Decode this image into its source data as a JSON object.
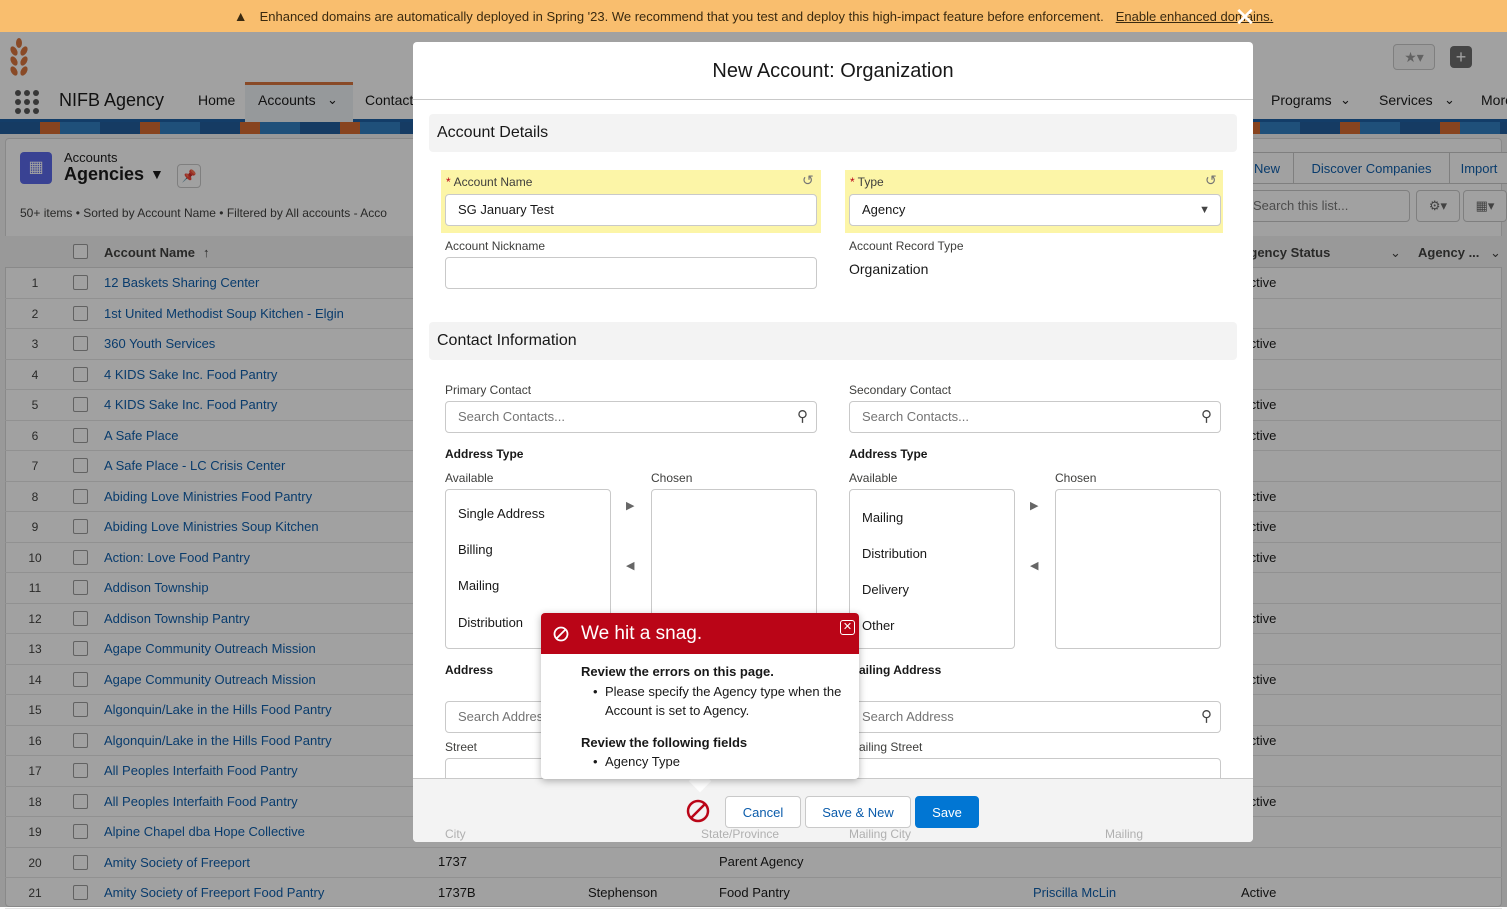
{
  "banner": {
    "text": "Enhanced domains are automatically deployed in Spring '23. We recommend that you test and deploy this high-impact feature before enforcement.",
    "link": "Enable enhanced domains."
  },
  "nav": {
    "app_name": "NIFB Agency",
    "tabs": [
      "Home",
      "Accounts",
      "Contact",
      "Programs",
      "Services",
      "More"
    ]
  },
  "list_view": {
    "object_label": "Accounts",
    "title": "Agencies",
    "meta": "50+ items • Sorted by Account Name • Filtered by All accounts - Acco",
    "buttons": [
      "New",
      "Discover Companies",
      "Import"
    ],
    "search_placeholder": "Search this list...",
    "columns": [
      "Account Name",
      "Agency Status",
      "Agency ..."
    ],
    "rows": [
      {
        "n": "1",
        "name": "12 Baskets Sharing Center",
        "status": "Active"
      },
      {
        "n": "2",
        "name": "1st United Methodist Soup Kitchen - Elgin",
        "status": ""
      },
      {
        "n": "3",
        "name": "360 Youth Services",
        "status": "Active"
      },
      {
        "n": "4",
        "name": "4 KIDS Sake Inc. Food Pantry",
        "status": ""
      },
      {
        "n": "5",
        "name": "4 KIDS Sake Inc. Food Pantry",
        "status": "Active"
      },
      {
        "n": "6",
        "name": "A Safe Place",
        "status": "Active"
      },
      {
        "n": "7",
        "name": "A Safe Place - LC Crisis Center",
        "status": ""
      },
      {
        "n": "8",
        "name": "Abiding Love Ministries Food Pantry",
        "status": "Active"
      },
      {
        "n": "9",
        "name": "Abiding Love Ministries Soup Kitchen",
        "status": "Active"
      },
      {
        "n": "10",
        "name": "Action: Love Food Pantry",
        "status": "Active"
      },
      {
        "n": "11",
        "name": "Addison Township",
        "status": ""
      },
      {
        "n": "12",
        "name": "Addison Township Pantry",
        "status": "Active"
      },
      {
        "n": "13",
        "name": "Agape Community Outreach Mission",
        "status": ""
      },
      {
        "n": "14",
        "name": "Agape Community Outreach Mission",
        "status": "Active"
      },
      {
        "n": "15",
        "name": "Algonquin/Lake in the Hills Food Pantry",
        "status": ""
      },
      {
        "n": "16",
        "name": "Algonquin/Lake in the Hills Food Pantry",
        "status": "Active"
      },
      {
        "n": "17",
        "name": "All Peoples Interfaith Food Pantry",
        "status": ""
      },
      {
        "n": "18",
        "name": "All Peoples Interfaith Food Pantry",
        "status": "Active"
      },
      {
        "n": "19",
        "name": "Alpine Chapel dba Hope Collective",
        "status": ""
      },
      {
        "n": "20",
        "name": "Amity Society of Freeport",
        "status": ""
      },
      {
        "n": "21",
        "name": "Amity Society of Freeport Food Pantry",
        "status": "Active"
      }
    ],
    "row20_extra": {
      "number": "1737",
      "type": "Parent Agency"
    },
    "row21_extra": {
      "number": "1737B",
      "county": "Stephenson",
      "type": "Food Pantry",
      "contact": "Priscilla McLin"
    }
  },
  "modal": {
    "title": "New Account: Organization",
    "sections": {
      "details": "Account Details",
      "contact": "Contact Information"
    },
    "account_name": {
      "label": "Account Name",
      "value": "SG January Test"
    },
    "type": {
      "label": "Type",
      "value": "Agency"
    },
    "nickname": {
      "label": "Account Nickname",
      "value": ""
    },
    "record_type": {
      "label": "Account Record Type",
      "value": "Organization"
    },
    "primary_contact": {
      "label": "Primary Contact",
      "placeholder": "Search Contacts..."
    },
    "secondary_contact": {
      "label": "Secondary Contact",
      "placeholder": "Search Contacts..."
    },
    "address_type_left": {
      "label": "Address Type",
      "available_label": "Available",
      "chosen_label": "Chosen",
      "available": [
        "Single Address",
        "Billing",
        "Mailing",
        "Distribution"
      ]
    },
    "address_type_right": {
      "label": "Address Type",
      "available_label": "Available",
      "chosen_label": "Chosen",
      "available": [
        "Mailing",
        "Distribution",
        "Delivery",
        "Other"
      ]
    },
    "address": {
      "label": "Address",
      "placeholder": "Search Address",
      "street": "Street"
    },
    "mailing_address": {
      "label": "Mailing Address",
      "placeholder": "Search Address",
      "street": "Mailing Street"
    },
    "faded_labels": [
      "City",
      "State/Province",
      "Mailing City",
      "Mailing"
    ],
    "footer": {
      "cancel": "Cancel",
      "save_new": "Save & New",
      "save": "Save"
    }
  },
  "error_popover": {
    "title": "We hit a snag.",
    "heading1": "Review the errors on this page.",
    "error": "Please specify the Agency type when the Account is set to Agency.",
    "heading2": "Review the following fields",
    "field": "Agency Type"
  },
  "colors": {
    "brand": "#0176d3",
    "error": "#ba0517",
    "highlight": "#fcf5a7",
    "banner": "#f9be6e"
  }
}
